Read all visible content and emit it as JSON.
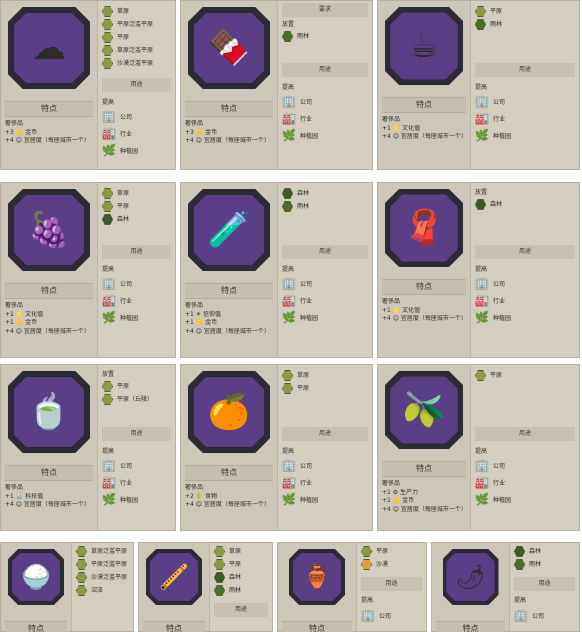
{
  "labels": {
    "traits": "特点",
    "uses": "用途",
    "requires": "要求",
    "terrain": "地形",
    "improve": "提高",
    "luxury": "奢侈品",
    "company": "公司",
    "industry": "行业",
    "plantation": "种植园"
  },
  "cards": [
    {
      "id": "cotton",
      "icon": "cotton-icon",
      "glyph": "☁",
      "yields": [
        "+3 🪙 金币",
        "+4 😊 宜居度（每座城市一个）"
      ],
      "terrain_header": "",
      "terrain": [
        {
          "name": "草原",
          "hex": "grass"
        },
        {
          "name": "平原泛滥平原",
          "hex": "grass"
        },
        {
          "name": "平原",
          "hex": "grass"
        },
        {
          "name": "草原泛滥平原",
          "hex": "grass"
        },
        {
          "name": "沙漠泛滥平原",
          "hex": "grass"
        }
      ],
      "uses_header": "用途"
    },
    {
      "id": "cocoa",
      "icon": "chocolate-icon",
      "glyph": "🍫",
      "yields": [
        "+3 🪙 金币",
        "+4 😊 宜居度（每座城市一个）"
      ],
      "terrain_header": "要求",
      "terrain_sub": "放置",
      "terrain": [
        {
          "name": "雨林",
          "hex": "jungle"
        }
      ],
      "uses_header": "用途"
    },
    {
      "id": "coffee",
      "icon": "coffee-sack-icon",
      "glyph": "☕",
      "yields": [
        "+1 ⭐ 文化值",
        "+4 😊 宜居度（每座城市一个）"
      ],
      "terrain_header": "",
      "terrain": [
        {
          "name": "平原",
          "hex": "grass"
        },
        {
          "name": "雨林",
          "hex": "jungle"
        }
      ],
      "uses_header": "用途"
    },
    {
      "id": "wine",
      "icon": "wine-grapes-icon",
      "glyph": "🍇",
      "yields": [
        "+1 ⭐ 文化值",
        "+1 🪙 金币",
        "+4 😊 宜居度（每座城市一个）"
      ],
      "terrain_header": "",
      "terrain": [
        {
          "name": "草原",
          "hex": "grass"
        },
        {
          "name": "平原",
          "hex": "grass"
        },
        {
          "name": "森林",
          "hex": "forest"
        }
      ],
      "uses_header": "用途"
    },
    {
      "id": "dyes",
      "icon": "dye-bottles-icon",
      "glyph": "🧪",
      "yields": [
        "+1 ⚜ 信仰值",
        "+1 🪙 金币",
        "+4 😊 宜居度（每座城市一个）"
      ],
      "terrain_header": "",
      "terrain": [
        {
          "name": "森林",
          "hex": "forest"
        },
        {
          "name": "雨林",
          "hex": "jungle"
        }
      ],
      "uses_header": "用途"
    },
    {
      "id": "silk",
      "icon": "silk-roll-icon",
      "glyph": "🧣",
      "yields": [
        "+1 ⭐ 文化值",
        "+4 😊 宜居度（每座城市一个）"
      ],
      "terrain_header": "",
      "terrain_sub": "放置",
      "terrain": [
        {
          "name": "森林",
          "hex": "forest"
        }
      ],
      "uses_header": "用途"
    },
    {
      "id": "tea",
      "icon": "tea-bag-icon",
      "glyph": "🍵",
      "yields": [
        "+1 🔬 科技值",
        "+4 😊 宜居度（每座城市一个）"
      ],
      "terrain_header": "",
      "terrain_sub": "放置",
      "terrain": [
        {
          "name": "平原",
          "hex": "grass"
        },
        {
          "name": "平原（丘陵）",
          "hex": "grass"
        }
      ],
      "uses_header": "用途"
    },
    {
      "id": "citrus",
      "icon": "orange-icon",
      "glyph": "🍊",
      "yields": [
        "+2 🌾 食物",
        "+4 😊 宜居度（每座城市一个）"
      ],
      "terrain_header": "",
      "terrain": [
        {
          "name": "草原",
          "hex": "grass"
        },
        {
          "name": "平原",
          "hex": "grass"
        }
      ],
      "uses_header": "用途"
    },
    {
      "id": "olives",
      "icon": "olive-branch-icon",
      "glyph": "🫒",
      "yields": [
        "+1 ⚙ 生产力",
        "+1 🪙 金币",
        "+4 😊 宜居度（每座城市一个）"
      ],
      "terrain_header": "",
      "terrain": [
        {
          "name": "平原",
          "hex": "grass"
        }
      ],
      "uses_header": "用途"
    }
  ],
  "bottom_cards": [
    {
      "id": "sugar",
      "icon": "sugar-bowl-icon",
      "glyph": "🍚",
      "title": "特点",
      "terrain": [
        {
          "name": "草原泛滥平原",
          "hex": "grass"
        },
        {
          "name": "平原泛滥平原",
          "hex": "grass"
        },
        {
          "name": "沙漠泛滥平原",
          "hex": "grass"
        },
        {
          "name": "沼泽",
          "hex": "grass"
        }
      ]
    },
    {
      "id": "tobacco",
      "icon": "pipe-icon",
      "glyph": "🪈",
      "title": "特点",
      "terrain": [
        {
          "name": "草原",
          "hex": "grass"
        },
        {
          "name": "平原",
          "hex": "grass"
        },
        {
          "name": "森林",
          "hex": "forest"
        },
        {
          "name": "雨林",
          "hex": "jungle"
        }
      ],
      "uses_header": "用途"
    },
    {
      "id": "incense",
      "icon": "incense-burner-icon",
      "glyph": "🏺",
      "title": "特点",
      "terrain": [
        {
          "name": "平原",
          "hex": "grass"
        },
        {
          "name": "沙漠",
          "hex": "desert"
        }
      ],
      "uses_header": "用途",
      "improve": "提高",
      "company": "公司"
    },
    {
      "id": "spices",
      "icon": "spices-icon",
      "glyph": "🌶",
      "title": "特点",
      "terrain": [
        {
          "name": "森林",
          "hex": "forest"
        },
        {
          "name": "雨林",
          "hex": "jungle"
        }
      ],
      "uses_header": "用途",
      "improve": "提高",
      "company": "公司"
    }
  ],
  "colors": {
    "card_bg": "#cfc9bb",
    "frame_dark": "#2c2a35",
    "frame_purple": "#5a3f86",
    "hex_grass": "#8a9a45",
    "hex_jungle": "#4d6b2c"
  }
}
